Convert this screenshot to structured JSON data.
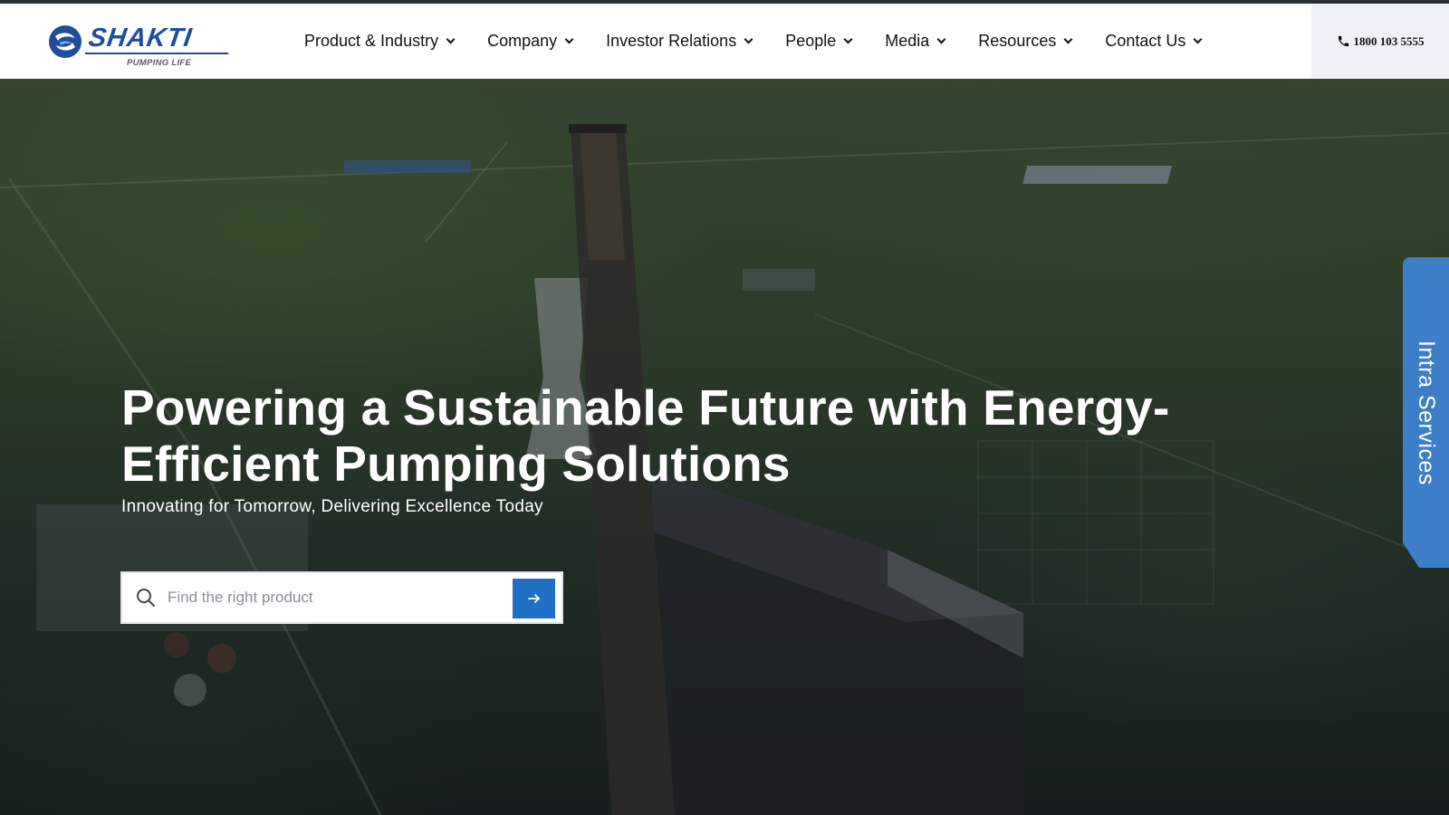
{
  "brand": {
    "name": "SHAKTI",
    "tagline": "PUMPING LIFE",
    "primary_color": "#1f4e9c",
    "accent_color": "#1f6fc5"
  },
  "nav": {
    "items": [
      {
        "label": "Product & Industry",
        "icon": "chevron-down-icon"
      },
      {
        "label": "Company",
        "icon": "chevron-down-icon"
      },
      {
        "label": "Investor Relations",
        "icon": "chevron-down-icon"
      },
      {
        "label": "People",
        "icon": "chevron-down-icon"
      },
      {
        "label": "Media",
        "icon": "chevron-down-icon"
      },
      {
        "label": "Resources",
        "icon": "chevron-down-icon"
      },
      {
        "label": "Contact Us",
        "icon": "chevron-down-icon"
      }
    ]
  },
  "phone": {
    "number": "1800 103 5555",
    "icon": "phone-icon"
  },
  "hero": {
    "title": "Powering a Sustainable Future with Energy-Efficient Pumping Solutions",
    "subtitle": "Innovating for Tomorrow, Delivering Excellence Today",
    "background": "aerial view of power plant chimney and landscape"
  },
  "search": {
    "placeholder": "Find the right product",
    "value": "",
    "search_icon": "search-icon",
    "submit_icon": "arrow-right-icon"
  },
  "side_tab": {
    "label": "Intra Services",
    "color": "#3c7ec8"
  }
}
